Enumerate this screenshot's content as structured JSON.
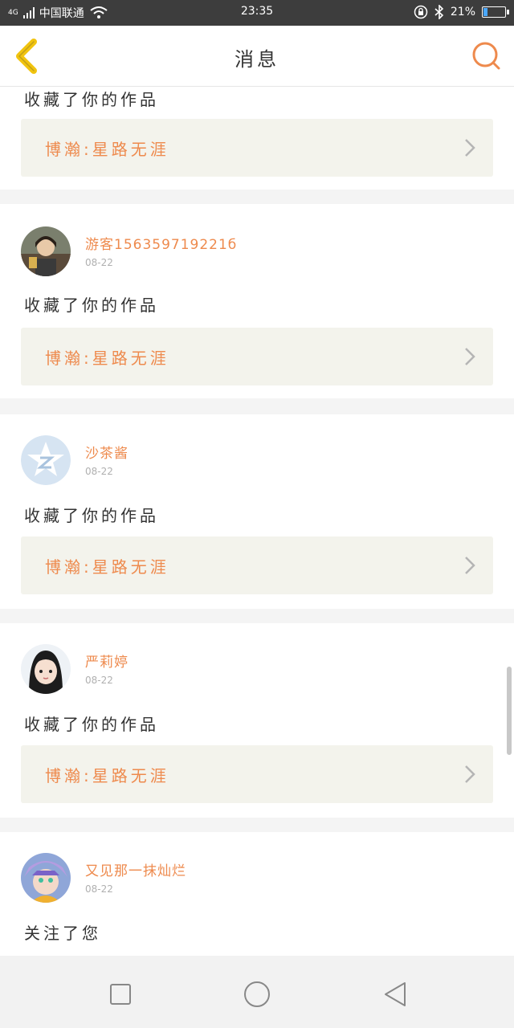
{
  "status_bar": {
    "network_type": "4G",
    "carrier": "中国联通",
    "time": "23:35",
    "battery_percent": "21%",
    "battery_level": 0.21,
    "icons": [
      "signal-icon",
      "wifi-icon",
      "rotation-lock-icon",
      "bluetooth-icon",
      "battery-icon"
    ]
  },
  "header": {
    "title": "消息",
    "back_icon": "chevron-left-icon",
    "search_icon": "search-icon"
  },
  "colors": {
    "accent": "#ee8a4d",
    "back_arrow": "#f1c40f",
    "work_box_bg": "#f3f3ec",
    "divider_bg": "#f4f4f4"
  },
  "messages": [
    {
      "username": "",
      "date": "",
      "action": "收藏了你的作品",
      "work_title": "博瀚:星路无涯",
      "partial": true
    },
    {
      "username": "游客156359719221б",
      "date": "08-22",
      "action": "收藏了你的作品",
      "work_title": "博瀚:星路无涯",
      "avatar": "photo-avatar"
    },
    {
      "username": "沙茶酱",
      "date": "08-22",
      "action": "收藏了你的作品",
      "work_title": "博瀚:星路无涯",
      "avatar": "qq-default-avatar"
    },
    {
      "username": "严莉婷",
      "date": "08-22",
      "action": "收藏了你的作品",
      "work_title": "博瀚:星路无涯",
      "avatar": "girl-avatar"
    },
    {
      "username": "又见那一抹灿烂",
      "date": "08-22",
      "action": "关注了您",
      "avatar": "anime-avatar"
    }
  ],
  "nav_bar": {
    "buttons": [
      "recent-apps-icon",
      "home-icon",
      "back-icon"
    ]
  }
}
